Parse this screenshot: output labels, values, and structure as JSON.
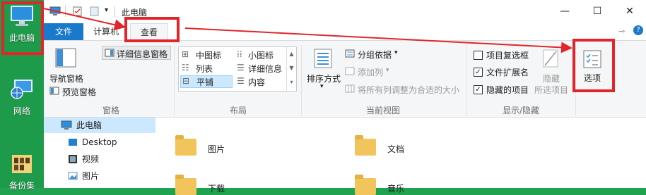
{
  "desktop": {
    "items": [
      {
        "label": "此电脑",
        "icon": "computer-icon"
      },
      {
        "label": "网络",
        "icon": "network-icon"
      },
      {
        "label": "备份集",
        "icon": "folder-icon"
      }
    ]
  },
  "window": {
    "title": "此电脑",
    "controls": {
      "minimize": "—",
      "maximize": "☐",
      "close": "✕"
    }
  },
  "tabs": {
    "file": "文件",
    "computer": "计算机",
    "view": "查看"
  },
  "ribbon": {
    "panes": {
      "nav_pane": "导航窗格",
      "preview_pane": "预览窗格",
      "details_pane": "详细信息窗格",
      "group_label": "窗格"
    },
    "layout": {
      "items": [
        "中图标",
        "小图标",
        "列表",
        "详细信息",
        "平铺",
        "内容"
      ],
      "selected": "平铺",
      "group_label": "布局"
    },
    "current_view": {
      "sort_by": "排序方式",
      "group_by": "分组依据",
      "add_column": "添加列",
      "fit_columns": "将所有列调整为合适的大小",
      "group_label": "当前视图"
    },
    "show_hide": {
      "item_checkboxes": "项目复选框",
      "file_extensions": "文件扩展名",
      "hidden_items": "隐藏的项目",
      "hide_selected": "隐藏",
      "hide_selected_sub": "所选项目",
      "group_label": "显示/隐藏",
      "item_checkboxes_checked": false,
      "file_extensions_checked": true,
      "hidden_items_checked": true
    },
    "options": "选项"
  },
  "nav": {
    "items": [
      "此电脑",
      "Desktop",
      "视频",
      "图片"
    ]
  },
  "content": {
    "folders": [
      "图片",
      "文档",
      "下载",
      "音乐"
    ]
  },
  "colors": {
    "accent": "#1979ca",
    "highlight": "#e0262a",
    "desktop": "#1d9b4a"
  }
}
